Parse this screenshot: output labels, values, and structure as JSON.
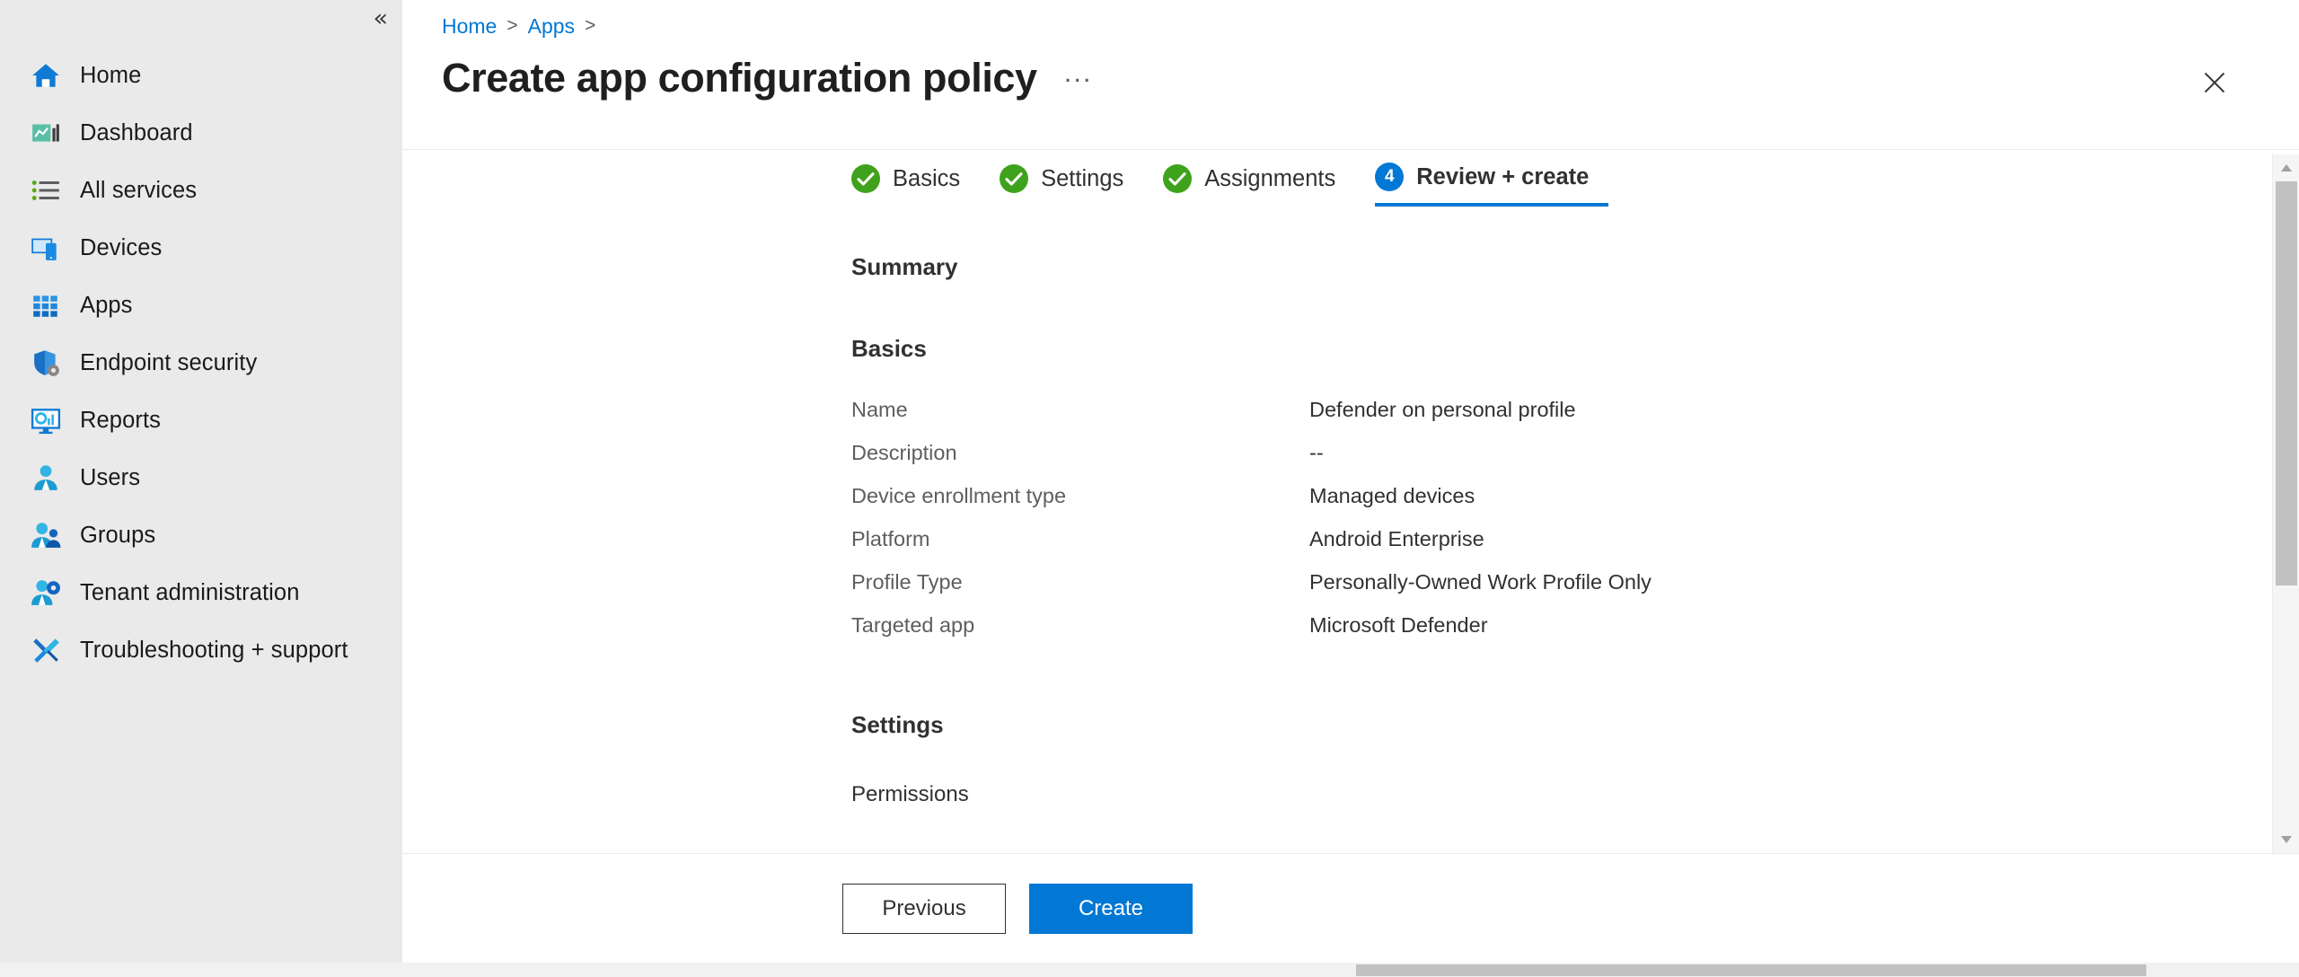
{
  "sidebar": {
    "collapse_label": "«",
    "items": [
      {
        "label": "Home",
        "icon": "home-icon"
      },
      {
        "label": "Dashboard",
        "icon": "dashboard-icon"
      },
      {
        "label": "All services",
        "icon": "all-services-icon"
      },
      {
        "label": "Devices",
        "icon": "devices-icon"
      },
      {
        "label": "Apps",
        "icon": "apps-grid-icon"
      },
      {
        "label": "Endpoint security",
        "icon": "shield-gear-icon"
      },
      {
        "label": "Reports",
        "icon": "reports-monitor-icon"
      },
      {
        "label": "Users",
        "icon": "user-icon"
      },
      {
        "label": "Groups",
        "icon": "groups-icon"
      },
      {
        "label": "Tenant administration",
        "icon": "tenant-admin-icon"
      },
      {
        "label": "Troubleshooting + support",
        "icon": "wrench-screwdriver-icon"
      }
    ]
  },
  "breadcrumb": {
    "items": [
      "Home",
      "Apps"
    ],
    "separator": ">"
  },
  "header": {
    "title": "Create app configuration policy",
    "ellipsis": "...",
    "close_icon": "close-icon"
  },
  "wizard": {
    "steps": [
      {
        "label": "Basics",
        "state": "done",
        "badge": "✓"
      },
      {
        "label": "Settings",
        "state": "done",
        "badge": "✓"
      },
      {
        "label": "Assignments",
        "state": "done",
        "badge": "✓"
      },
      {
        "label": "Review + create",
        "state": "active",
        "badge": "4"
      }
    ]
  },
  "content": {
    "summary_heading": "Summary",
    "basics_heading": "Basics",
    "basics_rows": [
      {
        "key": "Name",
        "value": "Defender on personal profile"
      },
      {
        "key": "Description",
        "value": "--"
      },
      {
        "key": "Device enrollment type",
        "value": "Managed devices"
      },
      {
        "key": "Platform",
        "value": "Android Enterprise"
      },
      {
        "key": "Profile Type",
        "value": "Personally-Owned Work Profile Only"
      },
      {
        "key": "Targeted app",
        "value": "Microsoft Defender"
      }
    ],
    "settings_heading": "Settings",
    "permissions_heading": "Permissions"
  },
  "footer": {
    "previous_label": "Previous",
    "create_label": "Create"
  },
  "colors": {
    "accent": "#0078d4",
    "success": "#3fa21c",
    "sidebar_bg": "#eaeaea",
    "text": "#323130",
    "muted_text": "#605e5c"
  }
}
